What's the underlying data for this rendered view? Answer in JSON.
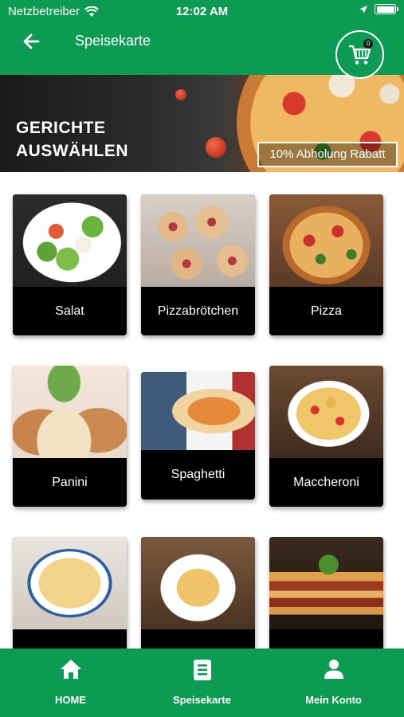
{
  "status_bar": {
    "carrier": "Netzbetreiber",
    "time": "12:02 AM"
  },
  "header": {
    "title": "Speisekarte",
    "cart_count": "0"
  },
  "banner": {
    "title_line1": "GERICHTE",
    "title_line2": "AUSWÄHLEN",
    "discount": "10% Abholung Rabatt"
  },
  "categories": [
    {
      "label": "Salat"
    },
    {
      "label": "Pizzabrötchen"
    },
    {
      "label": "Pizza"
    },
    {
      "label": "Panini"
    },
    {
      "label": "Spaghetti"
    },
    {
      "label": "Maccheroni"
    },
    {
      "label": ""
    },
    {
      "label": ""
    },
    {
      "label": ""
    }
  ],
  "bottom_nav": [
    {
      "label": "HOME",
      "icon": "home-icon"
    },
    {
      "label": "Speisekarte",
      "icon": "menu-list-icon"
    },
    {
      "label": "Mein Konto",
      "icon": "user-icon"
    }
  ],
  "colors": {
    "primary_green": "#0d9a52",
    "card_bg": "#000000"
  }
}
